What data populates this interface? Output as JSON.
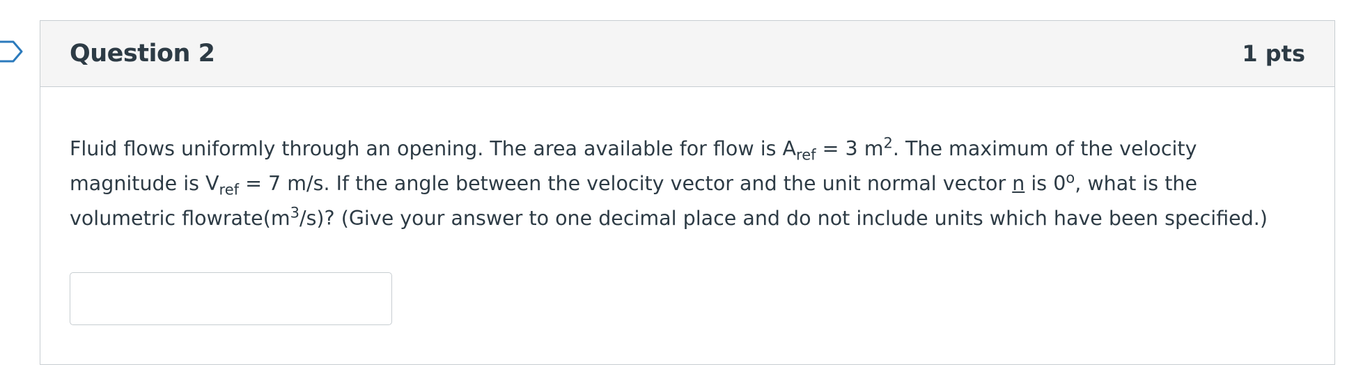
{
  "question": {
    "title": "Question 2",
    "points": "1 pts",
    "flag_icon": "bookmark-flag-icon",
    "text": {
      "line1_a": "Fluid flows uniformly through an opening. The area available for flow is A",
      "line1_sub": "ref",
      "line1_b": " = 3 m",
      "line1_sup": "2",
      "line1_c": ".  The maximum of the velocity",
      "line2_a": "magnitude is V",
      "line2_sub": "ref",
      "line2_b": " = 7 m/s.  If the angle between the velocity vector and the unit normal vector ",
      "line2_u": "n",
      "line2_c": " is 0",
      "line2_sup": "o",
      "line2_d": ", what is the",
      "line3_a": "volumetric flowrate(m",
      "line3_sup": "3",
      "line3_b": "/s)? (Give your answer to one decimal place and do not include units which have been specified.)"
    },
    "answer": {
      "value": "",
      "placeholder": ""
    }
  },
  "colors": {
    "header_bg": "#f5f5f5",
    "border": "#c7cdd1",
    "text": "#2d3b45",
    "flag": "#2b7abc"
  }
}
